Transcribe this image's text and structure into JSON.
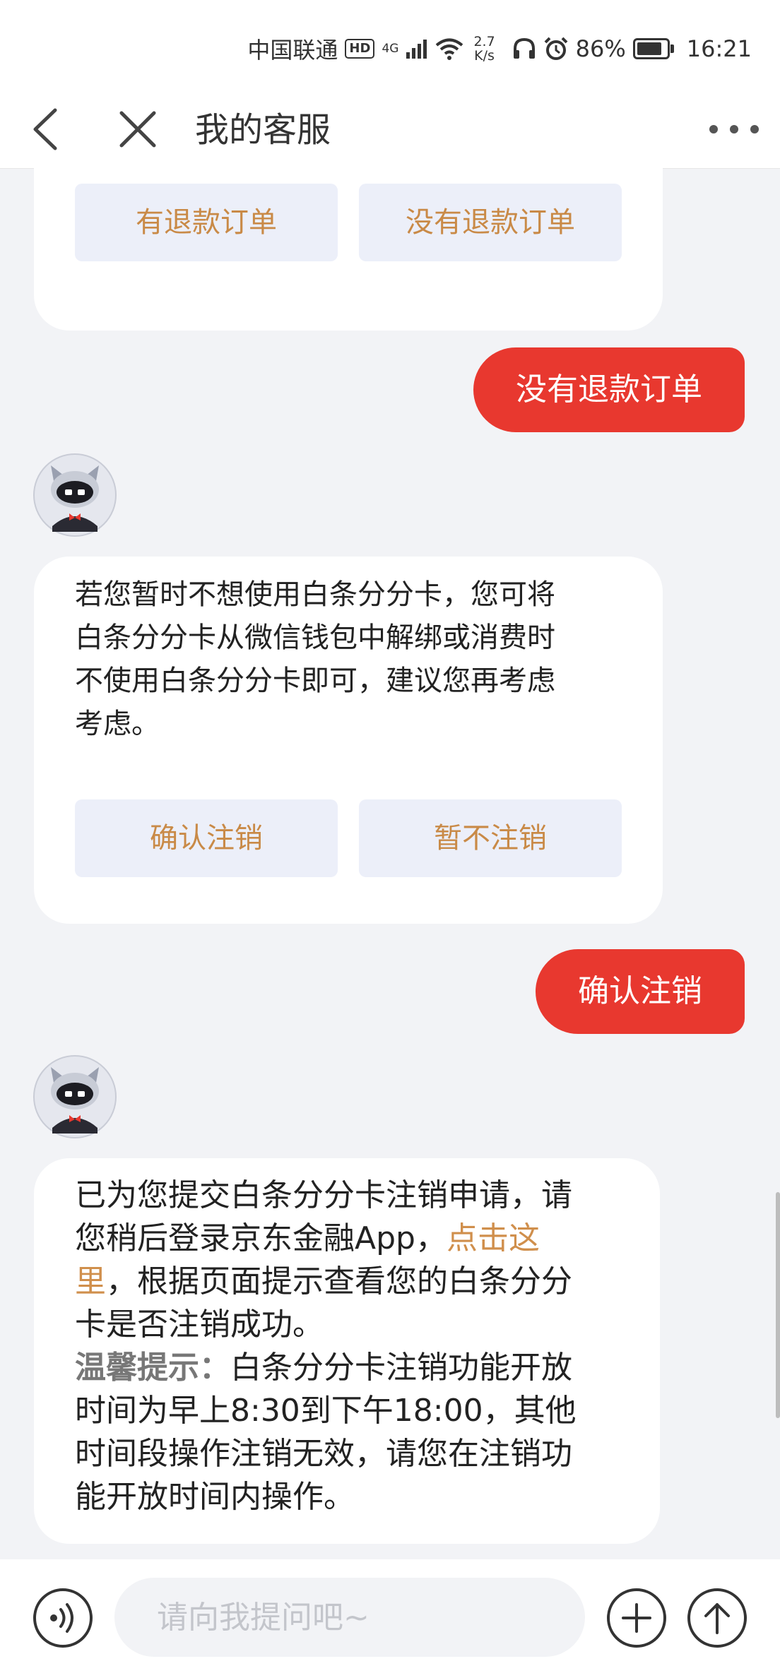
{
  "status_bar": {
    "carrier": "中国联通",
    "hd": "HD",
    "network": "4G",
    "speed_value": "2.7",
    "speed_unit": "K/s",
    "battery_text": "86%",
    "battery_level": 0.86,
    "time": "16:21"
  },
  "nav": {
    "title": "我的客服"
  },
  "messages": {
    "card1": {
      "options": [
        "有退款订单",
        "没有退款订单"
      ]
    },
    "user1": "没有退款订单",
    "bot2": {
      "lines": [
        "若您暂时不想使用白条分分卡，您可将",
        "白条分分卡从微信钱包中解绑或消费时",
        "不使用白条分分卡即可，建议您再考虑",
        "考虑。"
      ],
      "options": [
        "确认注销",
        "暂不注销"
      ]
    },
    "user2": "确认注销",
    "bot3": {
      "line1": "已为您提交白条分分卡注销申请，请",
      "line2_text": "您稍后登录京东金融App，",
      "line2_link": "点击这",
      "line3_link": "里",
      "line3_text": "，根据页面提示查看您的白条分分",
      "line4": "卡是否注销成功。",
      "tip_label": "温馨提示：",
      "tip_line1": "白条分分卡注销功能开放",
      "tip_line2": "时间为早上8:30到下午18:00，其他",
      "tip_line3": "时间段操作注销无效，请您在注销功",
      "tip_line4": "能开放时间内操作。"
    }
  },
  "input": {
    "placeholder": "请向我提问吧~"
  },
  "colors": {
    "accent_red": "#e8382f",
    "option_text": "#c98a47",
    "link": "#d08f4c"
  },
  "icons": {
    "back": "chevron-left-icon",
    "close": "close-icon",
    "more": "more-icon",
    "voice": "voice-icon",
    "plus": "plus-icon",
    "send": "arrow-up-icon"
  }
}
